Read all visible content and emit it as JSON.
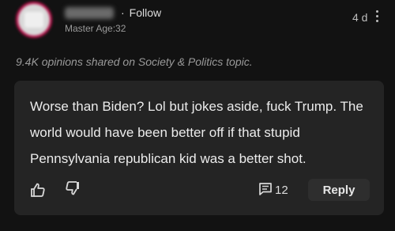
{
  "author": {
    "follow_label": "Follow",
    "follow_sep": "·",
    "meta": "Master Age:32",
    "time": "4 d"
  },
  "topic_stats": "9.4K opinions shared on Society & Politics topic.",
  "comment": {
    "text": "Worse than Biden? Lol but jokes aside, fuck Trump. The world would have been better off if that stupid Pennsylvania republican kid was a better shot.",
    "reply_count": "12",
    "reply_label": "Reply"
  },
  "icons": {
    "like": "thumbs-up-icon",
    "dislike": "thumbs-down-icon",
    "replies": "comment-icon",
    "more": "kebab-menu-icon"
  }
}
